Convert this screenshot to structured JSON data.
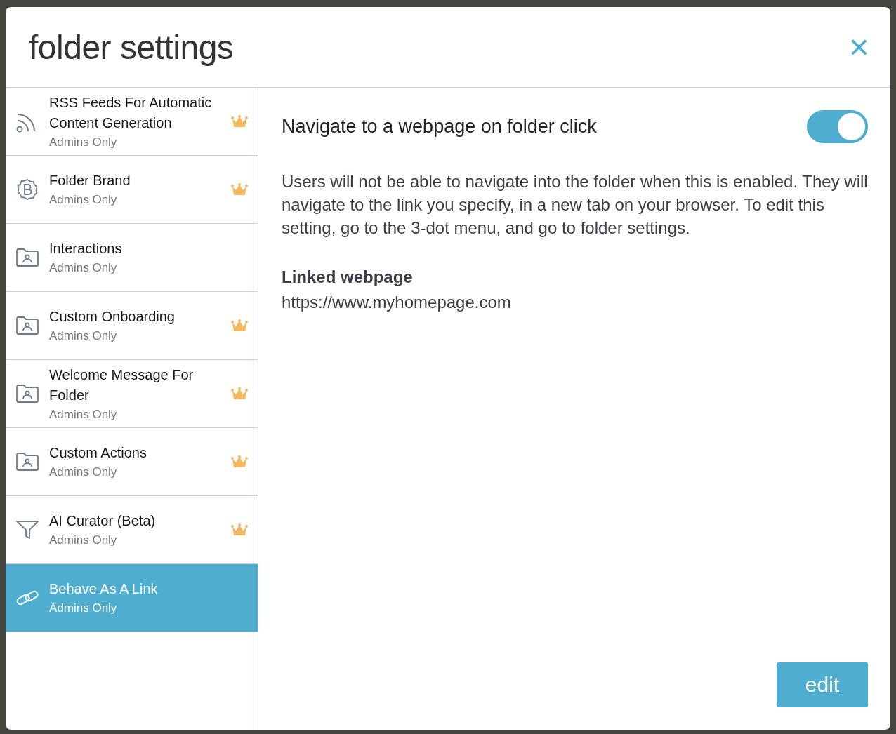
{
  "dialog": {
    "title": "folder settings",
    "close": "×"
  },
  "sidebar": {
    "items": [
      {
        "kind": "rss",
        "label": "RSS Feeds For Automatic Content Generation",
        "sublabel": "Admins Only",
        "premium": true,
        "selected": false
      },
      {
        "kind": "brand",
        "label": "Folder Brand",
        "sublabel": "Admins Only",
        "premium": true,
        "selected": false
      },
      {
        "kind": "folder",
        "label": "Interactions",
        "sublabel": "Admins Only",
        "premium": false,
        "selected": false
      },
      {
        "kind": "folder",
        "label": "Custom Onboarding",
        "sublabel": "Admins Only",
        "premium": true,
        "selected": false
      },
      {
        "kind": "folder",
        "label": "Welcome Message For Folder",
        "sublabel": "Admins Only",
        "premium": true,
        "selected": false
      },
      {
        "kind": "folder",
        "label": "Custom Actions",
        "sublabel": "Admins Only",
        "premium": true,
        "selected": false
      },
      {
        "kind": "funnel",
        "label": "AI Curator (Beta)",
        "sublabel": "Admins Only",
        "premium": true,
        "selected": false
      },
      {
        "kind": "link",
        "label": "Behave As A Link",
        "sublabel": "Admins Only",
        "premium": false,
        "selected": true
      }
    ]
  },
  "panel": {
    "setting_label": "Navigate to a webpage on folder click",
    "on": true,
    "description": "Users will not be able to navigate into the folder when this is enabled. They will navigate to the link you specify, in a new tab on your browser. To edit this setting, go to the 3-dot menu, and go to folder settings.",
    "field_label": "Linked webpage",
    "field_value": "https://www.myhomepage.com",
    "button": "edit"
  }
}
